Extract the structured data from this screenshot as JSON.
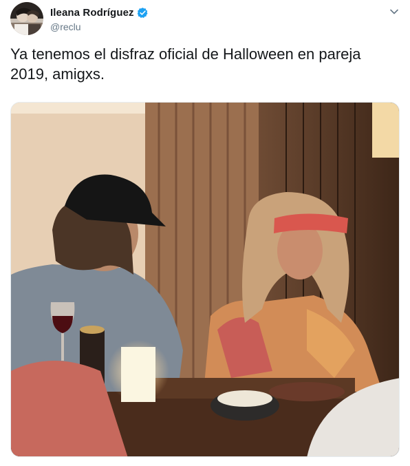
{
  "tweet": {
    "author": {
      "display_name": "Ileana Rodríguez",
      "handle": "@reclu",
      "verified": true
    },
    "text": "Ya tenemos el disfraz oficial de Halloween en pareja 2019, amigxs.",
    "menu_icon": "chevron-down-icon",
    "media": {
      "type": "photo"
    }
  },
  "colors": {
    "text_primary": "#14171a",
    "text_secondary": "#657786",
    "verified_blue": "#1da1f2",
    "border": "#e6ecf0"
  }
}
